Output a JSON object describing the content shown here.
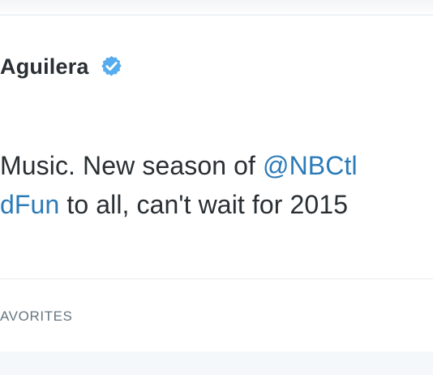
{
  "tweet": {
    "display_name": "Aguilera",
    "verified_icon": "verified-badge-icon",
    "text_line1_start": "Music. New season of ",
    "text_line1_mention": "@NBCtl",
    "text_line2_hashtag": "dFun",
    "text_line2_end": " to all, can't wait for 2015",
    "stats_label": "AVORITES"
  },
  "colors": {
    "name": "#292f33",
    "text": "#292f33",
    "link": "#2b7bb9",
    "verified": "#55acee",
    "muted": "#66757f"
  }
}
